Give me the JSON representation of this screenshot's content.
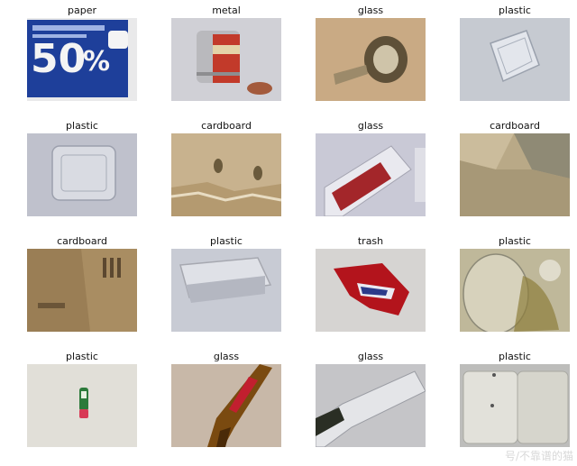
{
  "grid": {
    "items": [
      {
        "label": "paper",
        "thumb": "paper-bag-50-off-photo",
        "colors": [
          "#e9e9ea",
          "#1e3f9a"
        ]
      },
      {
        "label": "metal",
        "thumb": "metal-tin-can-photo",
        "colors": [
          "#d0d0d6",
          "#c23a2a"
        ]
      },
      {
        "label": "glass",
        "thumb": "glass-bottle-top-photo",
        "colors": [
          "#c9aa84",
          "#5e5038"
        ]
      },
      {
        "label": "plastic",
        "thumb": "plastic-clear-box-photo",
        "colors": [
          "#c6cad1",
          "#a9b0bc"
        ]
      },
      {
        "label": "plastic",
        "thumb": "plastic-tray-photo",
        "colors": [
          "#bfc1cc",
          "#d9dbe2"
        ]
      },
      {
        "label": "cardboard",
        "thumb": "cardboard-torn-photo",
        "colors": [
          "#c8b28e",
          "#6a5a3c"
        ]
      },
      {
        "label": "glass",
        "thumb": "glass-jar-label-photo",
        "colors": [
          "#c9c9d6",
          "#a3262a"
        ]
      },
      {
        "label": "cardboard",
        "thumb": "cardboard-box-interior-photo",
        "colors": [
          "#b9a987",
          "#8f8a75"
        ]
      },
      {
        "label": "cardboard",
        "thumb": "cardboard-flat-printed-photo",
        "colors": [
          "#a98d62",
          "#5c4830"
        ]
      },
      {
        "label": "plastic",
        "thumb": "plastic-clamshell-photo",
        "colors": [
          "#c8cbd4",
          "#a6a8b0"
        ]
      },
      {
        "label": "trash",
        "thumb": "trash-snack-wrapper-photo",
        "colors": [
          "#d6d4d2",
          "#b3141c"
        ]
      },
      {
        "label": "plastic",
        "thumb": "plastic-dirty-container-photo",
        "colors": [
          "#bfb89a",
          "#8d7d3b"
        ]
      },
      {
        "label": "plastic",
        "thumb": "plastic-small-bottle-photo",
        "colors": [
          "#e1dfd8",
          "#2c7a3a"
        ]
      },
      {
        "label": "glass",
        "thumb": "glass-brown-bottle-photo",
        "colors": [
          "#c8b8a8",
          "#7a4a10"
        ]
      },
      {
        "label": "glass",
        "thumb": "glass-clear-bottle-photo",
        "colors": [
          "#c5c5c8",
          "#2a2e24"
        ]
      },
      {
        "label": "plastic",
        "thumb": "plastic-white-container-photo",
        "colors": [
          "#bdbdbb",
          "#e2e1da"
        ]
      }
    ]
  },
  "watermark": {
    "text": "号/不靠谱的猫"
  }
}
